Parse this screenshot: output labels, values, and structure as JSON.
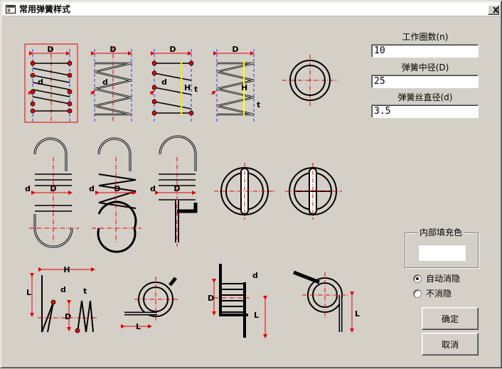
{
  "window": {
    "title": "常用弹簧样式",
    "close_glyph": "X"
  },
  "params": {
    "coils_label": "工作圈数(n)",
    "coils_value": "10",
    "mean_dia_label": "弹簧中径(D)",
    "mean_dia_value": "25",
    "wire_dia_label": "弹簧丝直径(d)",
    "wire_dia_value": "3.5"
  },
  "fill": {
    "label": "内部填充色",
    "color": "#ffffff"
  },
  "options": {
    "auto_hide": "自动消隐",
    "no_hide": "不消隐",
    "selected": "auto_hide"
  },
  "buttons": {
    "ok": "确定",
    "cancel": "取消"
  },
  "drawing_labels": {
    "D": "D",
    "d": "d",
    "H": "H",
    "t": "t",
    "L": "L"
  },
  "colors": {
    "accent_red": "#e00000",
    "axis_blue": "#3030ff",
    "yellow": "#ffff00"
  }
}
